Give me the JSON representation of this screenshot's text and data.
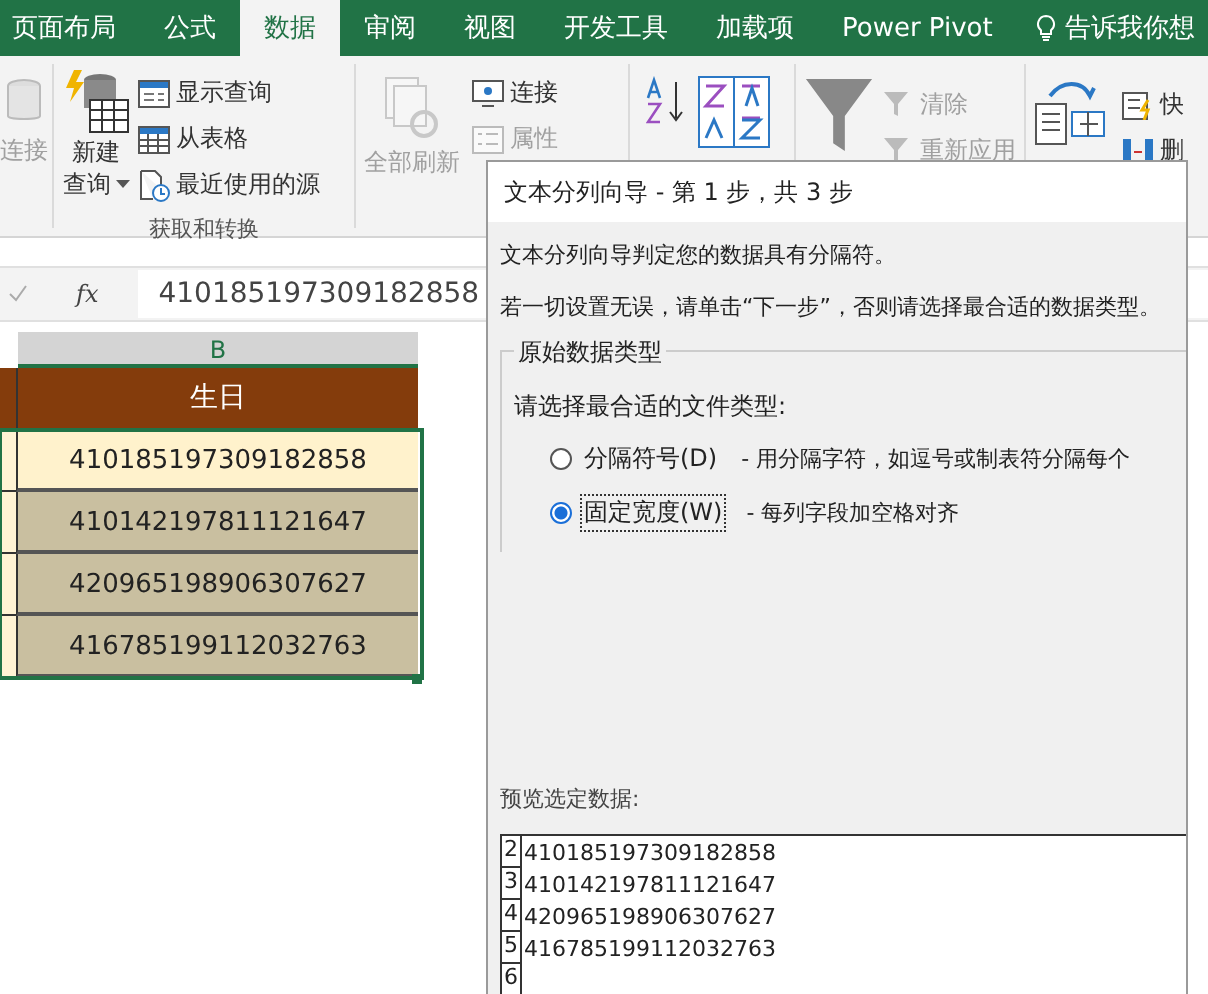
{
  "ribbon_tabs": [
    {
      "label": "页面布局",
      "selected": false
    },
    {
      "label": "公式",
      "selected": false
    },
    {
      "label": "数据",
      "selected": true
    },
    {
      "label": "审阅",
      "selected": false
    },
    {
      "label": "视图",
      "selected": false
    },
    {
      "label": "开发工具",
      "selected": false
    },
    {
      "label": "加载项",
      "selected": false
    },
    {
      "label": "Power Pivot",
      "selected": false
    }
  ],
  "tell_me": "告诉我你想",
  "ribbon": {
    "existing_connections": {
      "label": "连接",
      "disabled": true
    },
    "new_query": {
      "lines": [
        "新建",
        "查询"
      ]
    },
    "query_buttons": [
      {
        "label": "显示查询",
        "disabled": false
      },
      {
        "label": "从表格",
        "disabled": false
      },
      {
        "label": "最近使用的源",
        "disabled": false
      }
    ],
    "group_label": "获取和转换",
    "refresh_all": {
      "label": "全部刷新",
      "disabled": true
    },
    "connection_buttons": [
      {
        "label": "连接",
        "disabled": false
      },
      {
        "label": "属性",
        "disabled": true
      }
    ],
    "filter_buttons": [
      {
        "label": "清除",
        "disabled": true
      },
      {
        "label": "重新应用",
        "disabled": true
      }
    ],
    "tool_buttons": [
      {
        "label": "快"
      },
      {
        "label": "删"
      }
    ]
  },
  "formula_bar": {
    "function_label": "fx",
    "value": "410185197309182858"
  },
  "sheet": {
    "column": "B",
    "header": "生日",
    "rows": [
      {
        "value": "410185197309182858",
        "active": true
      },
      {
        "value": "410142197811121647",
        "active": false
      },
      {
        "value": "420965198906307627",
        "active": false
      },
      {
        "value": "416785199112032763",
        "active": false
      }
    ]
  },
  "dialog": {
    "title": "文本分列向导 - 第 1 步，共 3 步",
    "intro": "文本分列向导判定您的数据具有分隔符。",
    "instruction": "若一切设置无误，请单击“下一步”，否则请选择最合适的数据类型。",
    "group_title": "原始数据类型",
    "prompt": "请选择最合适的文件类型:",
    "options": [
      {
        "label": "分隔符号(D)",
        "description": "- 用分隔字符，如逗号或制表符分隔每个",
        "selected": false
      },
      {
        "label": "固定宽度(W)",
        "description": "- 每列字段加空格对齐",
        "selected": true
      }
    ],
    "preview_label": "预览选定数据:",
    "preview_rows": [
      {
        "number": "2",
        "text": "410185197309182858"
      },
      {
        "number": "3",
        "text": "410142197811121647"
      },
      {
        "number": "4",
        "text": "420965198906307627"
      },
      {
        "number": "5",
        "text": "416785199112032763"
      },
      {
        "number": "6"
      }
    ]
  }
}
